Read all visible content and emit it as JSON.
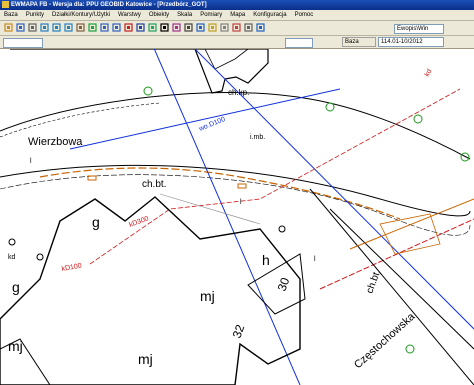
{
  "window": {
    "title": "EWMAPA FB - Wersja dla: PPU GEOBID Katowice - [Przedbórz_GOT]"
  },
  "menu": [
    "Baza",
    "Punkty",
    "Działki/Kontury/Użytki",
    "Warstwy",
    "Obiekty",
    "Skala",
    "Pomiary",
    "Mapa",
    "Konfiguracja",
    "Pomoc"
  ],
  "toolbar": {
    "icons": [
      "folder-icon",
      "save-icon",
      "print-icon",
      "zoom-in-icon",
      "zoom-out-icon",
      "zoom-window-icon",
      "pan-icon",
      "refresh-icon",
      "undo-icon",
      "redo-icon",
      "point-icon",
      "line-icon",
      "polygon-icon",
      "text-icon",
      "measure-icon",
      "select-icon",
      "info-icon",
      "layers-icon",
      "grid-icon",
      "snap-icon",
      "settings-icon",
      "help-icon"
    ],
    "layer_select": "Ewopis\\Win",
    "base_label": "Baza",
    "version_label": "114.01-10/2012"
  },
  "map": {
    "labels": {
      "street_north": "Wierzbowa",
      "street_south": "Częstochowska",
      "ch_kp": "ch.kp.",
      "ch_bt": "ch.bt.",
      "ch_bt_vertical": "ch.bt.",
      "imb": "i.mb.",
      "wo_dl": "wo.D100",
      "kd_dl1": "kD300",
      "kd_dl2": "kD100",
      "kd_top": "kd",
      "kd_left": "kd",
      "g1": "g",
      "g2": "g",
      "h": "h",
      "mj1": "mj",
      "mj2": "mj",
      "mj3": "mj",
      "num30": "30",
      "num32": "32",
      "l1": "l",
      "l2": "l",
      "l3": "l"
    }
  }
}
